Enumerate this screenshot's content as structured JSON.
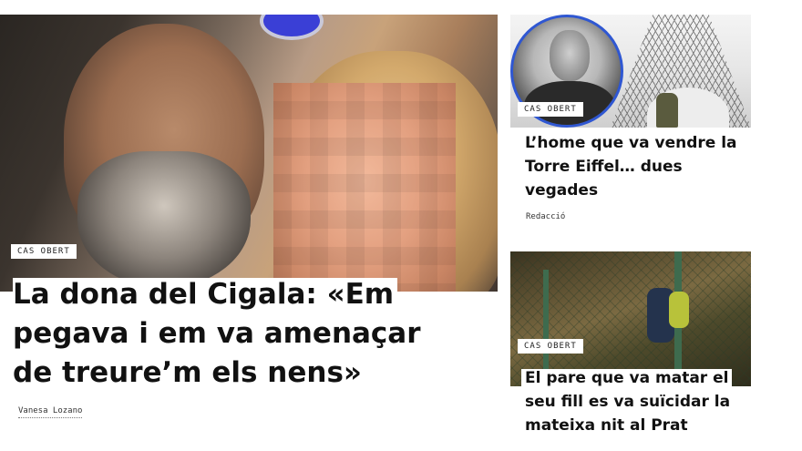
{
  "main_story": {
    "tag": "CAS OBERT",
    "headline": "La dona del Cigala: «Em pegava i em va amenaçar de treure’m els nens»",
    "author": "Vanesa Lozano"
  },
  "side_stories": [
    {
      "tag": "CAS OBERT",
      "headline": "L’home que va vendre la Torre Eiffel… dues vegades",
      "author": "Redacció"
    },
    {
      "tag": "CAS OBERT",
      "headline": "El pare que va matar el seu fill es va suïcidar la mateixa nit al Prat"
    }
  ],
  "colors": {
    "portrait_ring": "#2f57d2",
    "text": "#111111",
    "background": "#ffffff"
  }
}
